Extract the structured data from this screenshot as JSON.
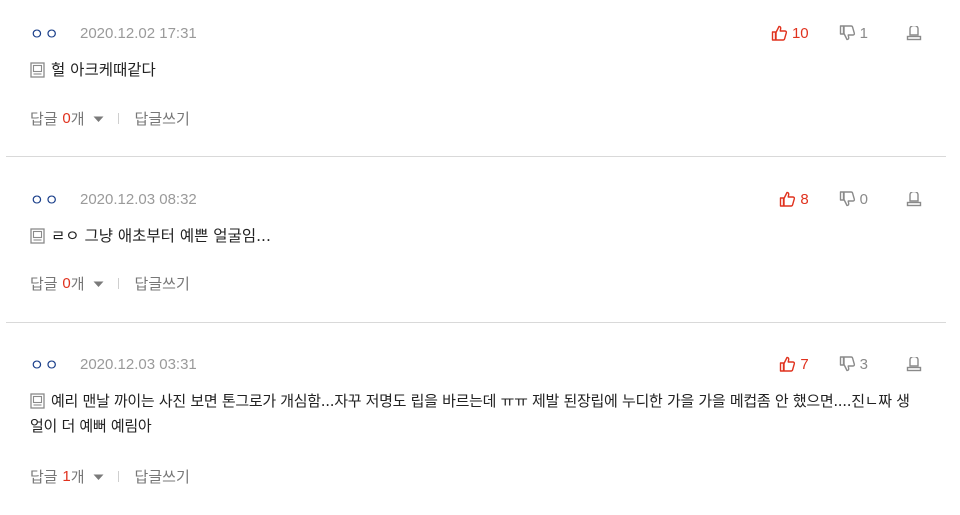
{
  "comments": [
    {
      "author": "ㅇㅇ",
      "date": "2020.12.02 17:31",
      "likes": "10",
      "dislikes": "1",
      "text": "헐 아크케때같다",
      "reply_label": "답글",
      "reply_count": "0",
      "reply_unit": "개",
      "write_reply": "답글쓰기"
    },
    {
      "author": "ㅇㅇ",
      "date": "2020.12.03 08:32",
      "likes": "8",
      "dislikes": "0",
      "text": "ㄹㅇ 그냥 애초부터 예쁜 얼굴임...",
      "reply_label": "답글",
      "reply_count": "0",
      "reply_unit": "개",
      "write_reply": "답글쓰기"
    },
    {
      "author": "ㅇㅇ",
      "date": "2020.12.03 03:31",
      "likes": "7",
      "dislikes": "3",
      "text": "예리 맨날 까이는 사진 보면 톤그로가 개심함...자꾸 저명도 립을 바르는데 ㅠㅠ 제발 된장립에 누디한 가을 가을 메컵좀 안 했으면....진ㄴ짜 생얼이 더 예뻐 예림아",
      "reply_label": "답글",
      "reply_count": "1",
      "reply_unit": "개",
      "write_reply": "답글쓰기"
    }
  ],
  "colors": {
    "author": "#1a3f8a",
    "date": "#9a9a9a",
    "like": "#e0321e",
    "dislike": "#8a8a8a",
    "reply_count": "#e0321e",
    "divider": "#d9d9d9"
  },
  "icons": {
    "like": "thumbs-up-icon",
    "dislike": "thumbs-down-icon",
    "report": "report-icon",
    "mobile": "memo-icon",
    "caret": "caret-down-icon"
  }
}
